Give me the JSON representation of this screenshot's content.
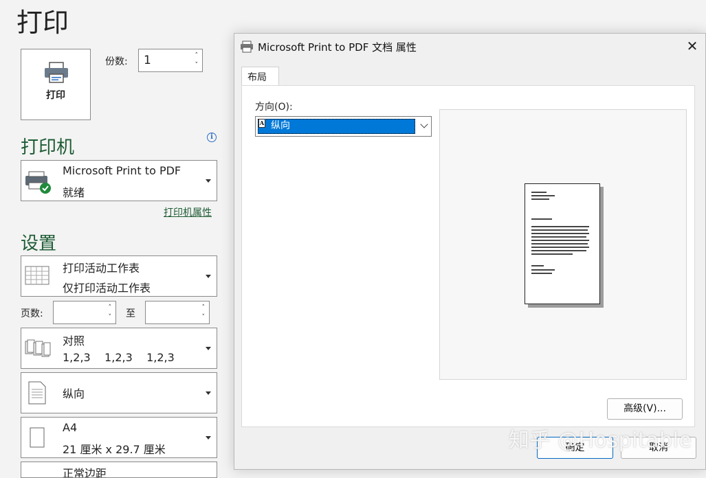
{
  "backstage": {
    "title": "打印",
    "print_button": "打印",
    "copies_label": "份数:",
    "copies_value": "1",
    "printer_heading": "打印机",
    "printer": {
      "name": "Microsoft Print to PDF",
      "status": "就绪"
    },
    "printer_properties_link": "打印机属性",
    "settings_heading": "设置",
    "scope": {
      "line1": "打印活动工作表",
      "line2": "仅打印活动工作表"
    },
    "pages_label": "页数:",
    "to_label": "至",
    "collate": {
      "line1": "对照",
      "line2": "1,2,3    1,2,3    1,2,3"
    },
    "orientation": {
      "line1": "纵向"
    },
    "paper": {
      "line1": "A4",
      "line2": "21 厘米 x 29.7 厘米"
    },
    "margins_partial": "正常边距"
  },
  "dialog": {
    "title": "Microsoft Print to PDF 文档 属性",
    "tab": "布局",
    "orientation_label": "方向(O):",
    "orientation_value": "纵向",
    "advanced_button": "高级(V)...",
    "ok_button": "确定",
    "cancel_button": "取消"
  },
  "watermark": "知乎 @Hospitable",
  "colors": {
    "accent_green": "#1e5c34",
    "selection_blue": "#0078d7"
  }
}
